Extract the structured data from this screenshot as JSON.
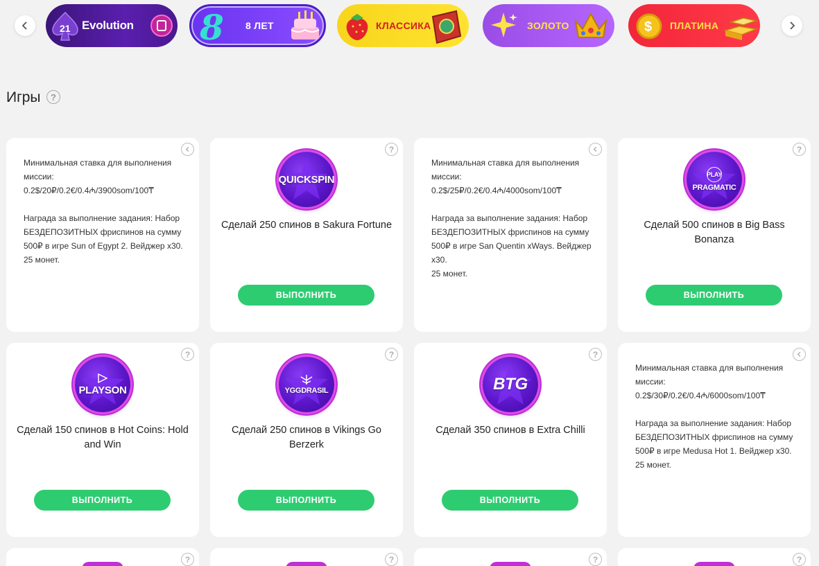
{
  "promos": {
    "evolution": "Evolution",
    "eight_years": "8 ЛЕТ",
    "klassika": "КЛАССИКА",
    "zoloto": "ЗОЛОТО",
    "platina": "ПЛАТИНА"
  },
  "section": {
    "title": "Игры",
    "help": "?"
  },
  "cards": [
    {
      "type": "details",
      "min_bet_label": "Минимальная ставка для выполнения миссии:",
      "min_bet_value": "0.2$/20₽/0.2€/0.4₼/3900som/100₸",
      "reward": "Награда за выполнение задания: Набор БЕЗДЕПОЗИТНЫХ фриспинов на сумму 500₽ в игре Sun of Egypt 2. Вейджер х30.",
      "coins": "25 монет."
    },
    {
      "type": "mission",
      "provider": "QUICKSPIN",
      "title": "Сделай 250 спинов в Sakura Fortune",
      "button": "ВЫПОЛНИТЬ"
    },
    {
      "type": "details",
      "min_bet_label": "Минимальная ставка для выполнения миссии:",
      "min_bet_value": "0.2$/25₽/0.2€/0.4₼/4000som/100₸",
      "reward": "Награда за выполнение задания: Набор БЕЗДЕПОЗИТНЫХ фриспинов на сумму 500₽ в игре San Quentin xWays. Вейджер х30.",
      "coins": "25 монет."
    },
    {
      "type": "mission",
      "provider": "PRAGMATIC",
      "provider_top": "PLAY",
      "title": "Сделай 500 спинов в Big Bass Bonanza",
      "button": "ВЫПОЛНИТЬ"
    },
    {
      "type": "mission",
      "provider": "PLAYSON",
      "title": "Сделай 150 спинов в Hot Coins: Hold and Win",
      "button": "ВЫПОЛНИТЬ"
    },
    {
      "type": "mission",
      "provider": "YGGDRASIL",
      "title": "Сделай 250 спинов в Vikings Go Berzerk",
      "button": "ВЫПОЛНИТЬ"
    },
    {
      "type": "mission",
      "provider": "BTG",
      "title": "Сделай 350 спинов в Extra Chilli",
      "button": "ВЫПОЛНИТЬ"
    },
    {
      "type": "details",
      "min_bet_label": "Минимальная ставка для выполнения миссии:",
      "min_bet_value": "0.2$/30₽/0.2€/0.4₼/6000som/100₸",
      "reward": "Награда за выполнение задания: Набор БЕЗДЕПОЗИТНЫХ фриспинов на сумму 500₽ в игре Medusa Hot 1. Вейджер х30.",
      "coins": "25 монет."
    }
  ],
  "icons": {
    "prev": "chevron-left-icon",
    "next": "chevron-right-icon",
    "help": "question-icon",
    "back": "back-arrow-icon"
  },
  "colors": {
    "accent_green": "#2ecc71",
    "background": "#f2f2f2"
  }
}
